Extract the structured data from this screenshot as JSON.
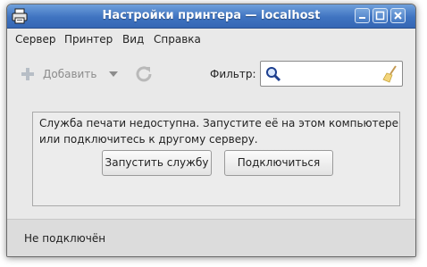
{
  "window": {
    "title": "Настройки принтера — localhost"
  },
  "menubar": {
    "items": [
      "Сервер",
      "Принтер",
      "Вид",
      "Справка"
    ]
  },
  "toolbar": {
    "add_label": "Добавить",
    "add_icon": "plus-icon",
    "dropdown_icon": "triangle-down-icon",
    "refresh_icon": "refresh-icon",
    "filter_label": "Фильтр:",
    "filter_value": "",
    "search_icon": "magnifier-icon",
    "clear_icon": "broom-icon"
  },
  "content": {
    "message": "Служба печати недоступна. Запустите её на этом компьютере или подключитесь к другому серверу.",
    "start_service_label": "Запустить службу",
    "connect_label": "Подключиться"
  },
  "status": {
    "text": "Не подключён"
  },
  "colors": {
    "titlebar": "#4479c4",
    "window_bg": "#e9e9e9",
    "statusbar_bg": "#dcdcdc"
  }
}
